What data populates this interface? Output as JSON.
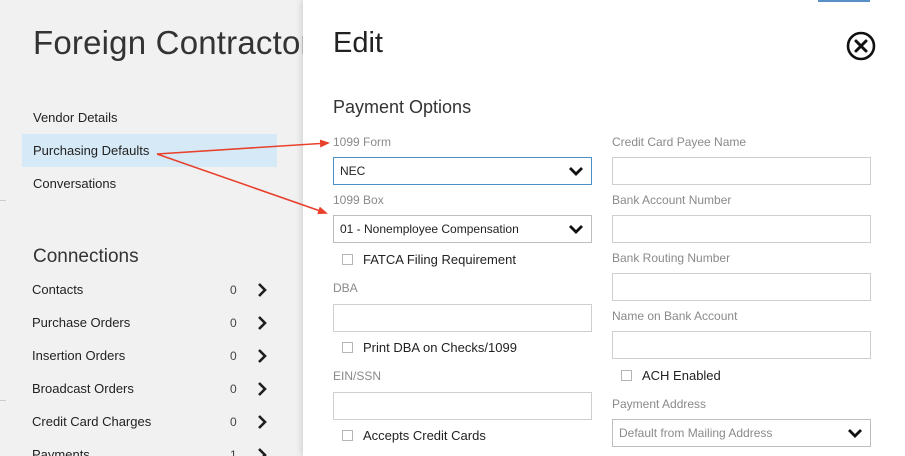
{
  "left": {
    "title": "Foreign Contractor",
    "nav": [
      {
        "label": "Vendor Details"
      },
      {
        "label": "Purchasing Defaults"
      },
      {
        "label": "Conversations"
      }
    ],
    "connections_title": "Connections",
    "connections": [
      {
        "label": "Contacts",
        "count": "0"
      },
      {
        "label": "Purchase Orders",
        "count": "0"
      },
      {
        "label": "Insertion Orders",
        "count": "0"
      },
      {
        "label": "Broadcast Orders",
        "count": "0"
      },
      {
        "label": "Credit Card Charges",
        "count": "0"
      },
      {
        "label": "Payments",
        "count": "1"
      }
    ]
  },
  "modal": {
    "title": "Edit",
    "section_title": "Payment Options",
    "form_1099": {
      "label": "1099 Form",
      "value": "NEC"
    },
    "box_1099": {
      "label": "1099 Box",
      "value": "01 - Nonemployee Compensation"
    },
    "fatca": {
      "label": "FATCA Filing Requirement",
      "checked": false
    },
    "dba": {
      "label": "DBA",
      "value": ""
    },
    "print_dba": {
      "label": "Print DBA on Checks/1099",
      "checked": false
    },
    "ein": {
      "label": "EIN/SSN",
      "value": ""
    },
    "accepts_cc": {
      "label": "Accepts Credit Cards",
      "checked": false
    },
    "cc_payee": {
      "label": "Credit Card Payee Name",
      "value": ""
    },
    "bank_account": {
      "label": "Bank Account Number",
      "value": ""
    },
    "bank_routing": {
      "label": "Bank Routing Number",
      "value": ""
    },
    "name_on_bank": {
      "label": "Name on Bank Account",
      "value": ""
    },
    "ach": {
      "label": "ACH Enabled",
      "checked": false
    },
    "payment_address": {
      "label": "Payment Address",
      "placeholder": "Default from Mailing Address"
    }
  },
  "colors": {
    "accent": "#4a8fc8",
    "annotation": "#e8412c",
    "active_nav": "#d6e9f6"
  },
  "icons": [
    "close-icon",
    "chevron-right-icon",
    "chevron-down-icon",
    "annotation-arrow"
  ]
}
